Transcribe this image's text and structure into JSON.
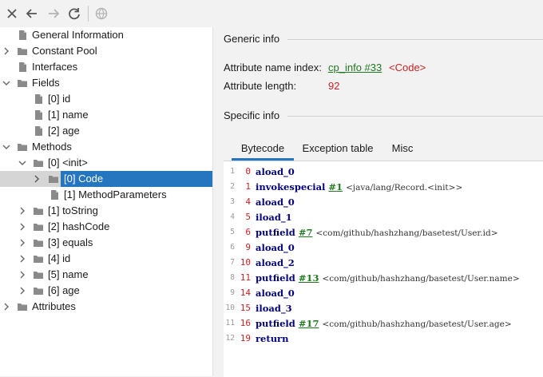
{
  "toolbar": {
    "icons": [
      "close-icon",
      "back-arrow-icon",
      "forward-arrow-icon",
      "refresh-icon",
      "web-globe-icon"
    ]
  },
  "tree": {
    "items": [
      {
        "label": "General Information",
        "icon": "file-icon"
      },
      {
        "label": "Constant Pool",
        "icon": "folder-icon"
      },
      {
        "label": "Interfaces",
        "icon": "file-icon"
      },
      {
        "label": "Fields",
        "icon": "folder-icon"
      },
      {
        "label": "[0] id",
        "icon": "file-icon"
      },
      {
        "label": "[1] name",
        "icon": "file-icon"
      },
      {
        "label": "[2] age",
        "icon": "file-icon"
      },
      {
        "label": "Methods",
        "icon": "folder-icon"
      },
      {
        "label": "[0] <init>",
        "icon": "folder-icon"
      },
      {
        "label": "[0] Code",
        "icon": "folder-icon"
      },
      {
        "label": "[1] MethodParameters",
        "icon": "file-icon"
      },
      {
        "label": "[1] toString",
        "icon": "folder-icon"
      },
      {
        "label": "[2] hashCode",
        "icon": "folder-icon"
      },
      {
        "label": "[3] equals",
        "icon": "folder-icon"
      },
      {
        "label": "[4] id",
        "icon": "folder-icon"
      },
      {
        "label": "[5] name",
        "icon": "folder-icon"
      },
      {
        "label": "[6] age",
        "icon": "folder-icon"
      },
      {
        "label": "Attributes",
        "icon": "folder-icon"
      }
    ]
  },
  "generic": {
    "title": "Generic info",
    "name_index_label": "Attribute name index:",
    "name_index_link": "cp_info #33",
    "name_index_value": "<Code>",
    "length_label": "Attribute length:",
    "length_value": "92"
  },
  "specific": {
    "title": "Specific info"
  },
  "tabs": [
    {
      "label": "Bytecode"
    },
    {
      "label": "Exception table"
    },
    {
      "label": "Misc"
    }
  ],
  "bytecode": [
    {
      "line": "1",
      "offset": "0",
      "instr": "aload_0",
      "ref": "",
      "comment": ""
    },
    {
      "line": "2",
      "offset": "1",
      "instr": "invokespecial",
      "ref": "#1",
      "comment": "<java/lang/Record.<init>>"
    },
    {
      "line": "3",
      "offset": "4",
      "instr": "aload_0",
      "ref": "",
      "comment": ""
    },
    {
      "line": "4",
      "offset": "5",
      "instr": "iload_1",
      "ref": "",
      "comment": ""
    },
    {
      "line": "5",
      "offset": "6",
      "instr": "putfield",
      "ref": "#7",
      "comment": "<com/github/hashzhang/basetest/User.id>"
    },
    {
      "line": "6",
      "offset": "9",
      "instr": "aload_0",
      "ref": "",
      "comment": ""
    },
    {
      "line": "7",
      "offset": "10",
      "instr": "aload_2",
      "ref": "",
      "comment": ""
    },
    {
      "line": "8",
      "offset": "11",
      "instr": "putfield",
      "ref": "#13",
      "comment": "<com/github/hashzhang/basetest/User.name>"
    },
    {
      "line": "9",
      "offset": "14",
      "instr": "aload_0",
      "ref": "",
      "comment": ""
    },
    {
      "line": "10",
      "offset": "15",
      "instr": "iload_3",
      "ref": "",
      "comment": ""
    },
    {
      "line": "11",
      "offset": "16",
      "instr": "putfield",
      "ref": "#17",
      "comment": "<com/github/hashzhang/basetest/User.age>"
    },
    {
      "line": "12",
      "offset": "19",
      "instr": "return",
      "ref": "",
      "comment": ""
    }
  ]
}
